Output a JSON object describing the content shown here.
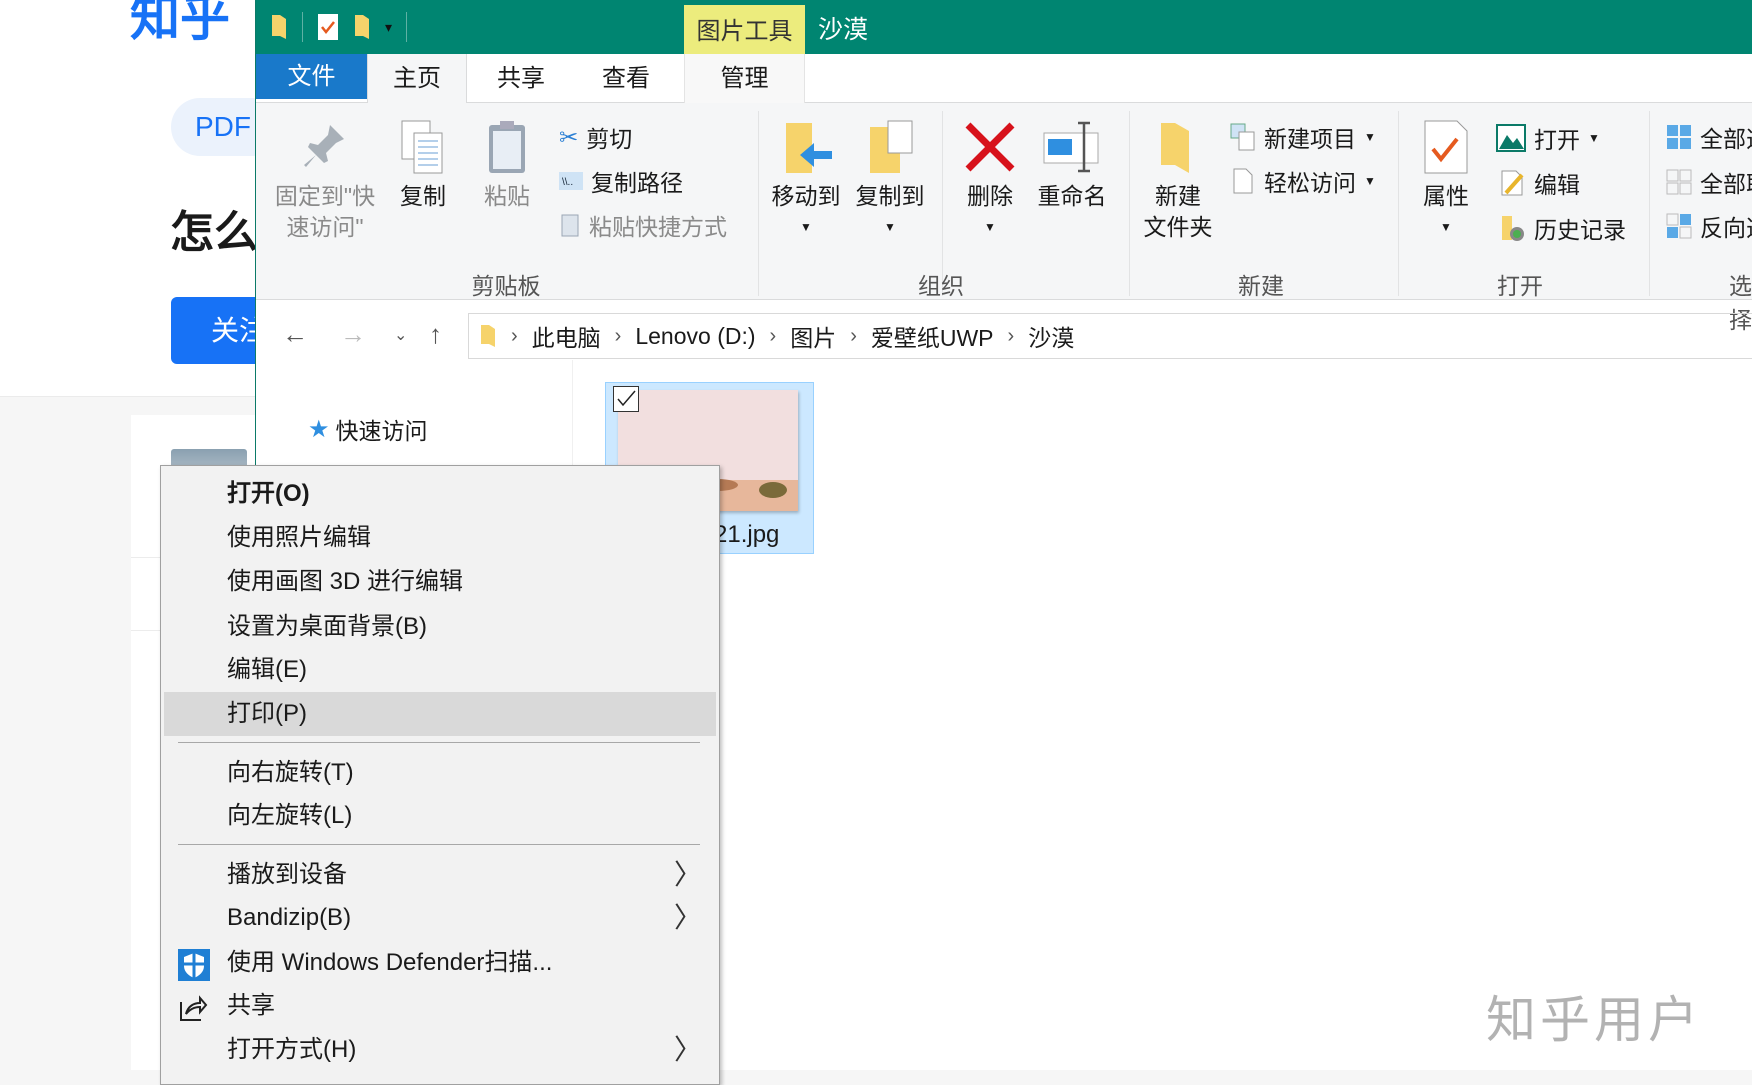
{
  "background": {
    "logo": "知乎",
    "pdf_tag": "PDF",
    "title": "怎么",
    "follow_button": "关注",
    "watermark": "知乎用户"
  },
  "explorer": {
    "title": "沙漠",
    "contextual_tab": "图片工具",
    "tabs": [
      "文件",
      "主页",
      "共享",
      "查看",
      "管理"
    ],
    "ribbon": {
      "clipboard": {
        "pin": "固定到\"快速访问\"",
        "pin_line1": "固定到\"快",
        "pin_line2": "速访问\"",
        "copy": "复制",
        "paste": "粘贴",
        "cut": "剪切",
        "copy_path": "复制路径",
        "paste_shortcut": "粘贴快捷方式",
        "label": "剪贴板"
      },
      "organize": {
        "move_to": "移动到",
        "copy_to": "复制到",
        "delete": "删除",
        "rename": "重命名",
        "label": "组织"
      },
      "new": {
        "new_folder_line1": "新建",
        "new_folder_line2": "文件夹",
        "new_item": "新建项目",
        "easy_access": "轻松访问",
        "label": "新建"
      },
      "open": {
        "properties": "属性",
        "open": "打开",
        "edit": "编辑",
        "history": "历史记录",
        "label": "打开"
      },
      "select": {
        "select_all": "全部选择",
        "select_none": "全部取消",
        "invert": "反向选择",
        "label": "选择"
      }
    },
    "address": {
      "crumbs": [
        "此电脑",
        "Lenovo (D:)",
        "图片",
        "爱壁纸UWP",
        "沙漠"
      ]
    },
    "nav": {
      "quick_access": "快速访问"
    },
    "file": {
      "name": "21.jpg",
      "selected": true
    }
  },
  "context_menu": {
    "items": [
      {
        "label": "打开(O)",
        "bold": true
      },
      {
        "label": "使用照片编辑"
      },
      {
        "label": "使用画图 3D 进行编辑"
      },
      {
        "label": "设置为桌面背景(B)"
      },
      {
        "label": "编辑(E)"
      },
      {
        "label": "打印(P)",
        "highlighted": true
      },
      {
        "label": "向右旋转(T)"
      },
      {
        "label": "向左旋转(L)"
      },
      {
        "label": "播放到设备",
        "submenu": true
      },
      {
        "label": "Bandizip(B)",
        "submenu": true
      },
      {
        "label": "使用 Windows Defender扫描...",
        "icon": "shield-icon"
      },
      {
        "label": "共享",
        "icon": "share-icon"
      },
      {
        "label": "打开方式(H)",
        "submenu": true
      }
    ]
  },
  "colors": {
    "titlebar": "#008571",
    "file_tab": "#1979ca",
    "contextual": "#ecec7d",
    "selection": "#cce8ff",
    "zhihu_blue": "#1772f6"
  }
}
